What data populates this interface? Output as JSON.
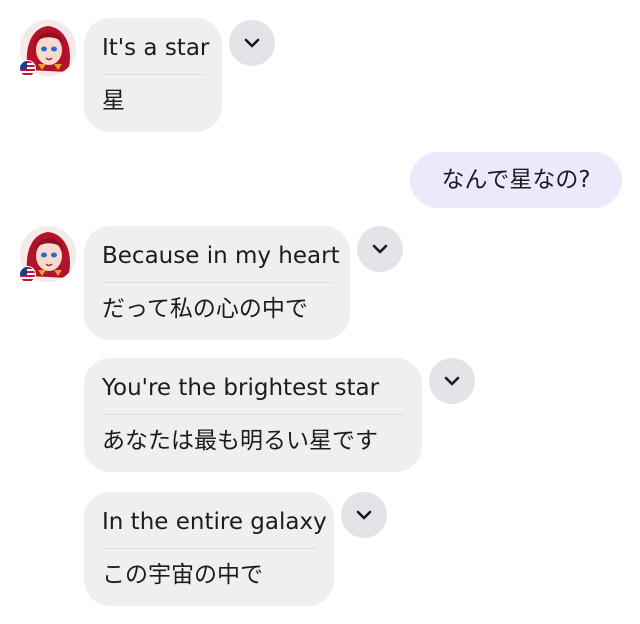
{
  "messages": [
    {
      "en": "It's a star",
      "ja": "星"
    },
    {
      "sent": "なんで星なの?"
    },
    {
      "en": "Because in my heart",
      "ja": "だって私の心の中で"
    },
    {
      "en": "You're the brightest star",
      "ja": "あなたは最も明るい星です"
    },
    {
      "en": "In the entire galaxy",
      "ja": "この宇宙の中で"
    }
  ],
  "colors": {
    "bubble": "#efeff1",
    "sent_bubble": "#ebe9fc",
    "chevron_bg": "#e4e4e8"
  },
  "icons": {
    "avatar": "character-avatar",
    "flag": "us-flag-icon",
    "expand": "chevron-down-icon"
  }
}
